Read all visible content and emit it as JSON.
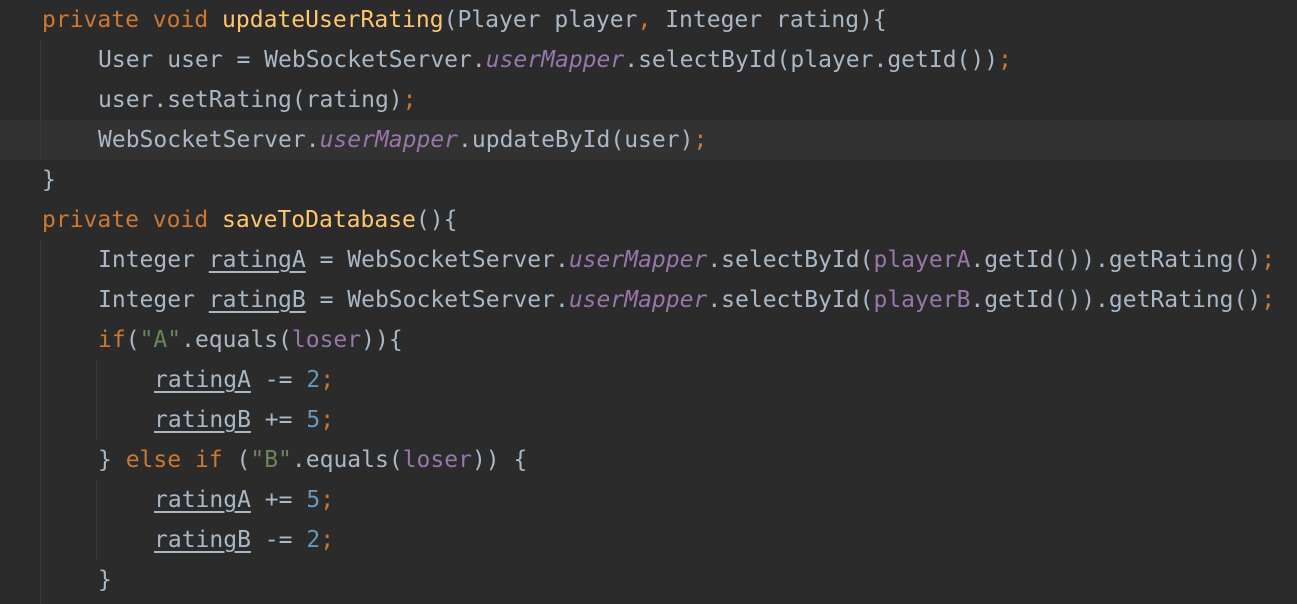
{
  "editor": {
    "theme_colors": {
      "background": "#2b2b2b",
      "current_line": "#323232",
      "keyword": "#cc7832",
      "method": "#ffc66d",
      "field": "#9876aa",
      "string": "#6a8759",
      "number": "#6897bb",
      "text": "#a9b7c6"
    },
    "lines": [
      {
        "tokens": [
          {
            "t": "private",
            "c": "kw"
          },
          {
            "t": " "
          },
          {
            "t": "void",
            "c": "kw"
          },
          {
            "t": " "
          },
          {
            "t": "updateUserRating",
            "c": "fn"
          },
          {
            "t": "(Player player"
          },
          {
            "t": ",",
            "c": "punc"
          },
          {
            "t": " Integer rating){"
          }
        ]
      },
      {
        "tokens": [
          {
            "t": "User user = WebSocketServer."
          },
          {
            "t": "userMapper",
            "c": "sfield"
          },
          {
            "t": ".selectById(player.getId())"
          },
          {
            "t": ";",
            "c": "punc"
          }
        ]
      },
      {
        "tokens": [
          {
            "t": "user.setRating(rating)"
          },
          {
            "t": ";",
            "c": "punc"
          }
        ]
      },
      {
        "tokens": [
          {
            "t": "WebSocketServer."
          },
          {
            "t": "userMapper",
            "c": "sfield"
          },
          {
            "t": ".updateById(user)"
          },
          {
            "t": ";",
            "c": "punc"
          }
        ]
      },
      {
        "tokens": [
          {
            "t": "}"
          }
        ]
      },
      {
        "tokens": [
          {
            "t": "private",
            "c": "kw"
          },
          {
            "t": " "
          },
          {
            "t": "void",
            "c": "kw"
          },
          {
            "t": " "
          },
          {
            "t": "saveToDatabase",
            "c": "fn"
          },
          {
            "t": "(){"
          }
        ]
      },
      {
        "tokens": [
          {
            "t": "Integer "
          },
          {
            "t": "ratingA",
            "c": "ul"
          },
          {
            "t": " = WebSocketServer."
          },
          {
            "t": "userMapper",
            "c": "sfield"
          },
          {
            "t": ".selectById("
          },
          {
            "t": "playerA",
            "c": "field"
          },
          {
            "t": ".getId()).getRating()"
          },
          {
            "t": ";",
            "c": "punc"
          }
        ]
      },
      {
        "tokens": [
          {
            "t": "Integer "
          },
          {
            "t": "ratingB",
            "c": "ul"
          },
          {
            "t": " = WebSocketServer."
          },
          {
            "t": "userMapper",
            "c": "sfield"
          },
          {
            "t": ".selectById("
          },
          {
            "t": "playerB",
            "c": "field"
          },
          {
            "t": ".getId()).getRating()"
          },
          {
            "t": ";",
            "c": "punc"
          }
        ]
      },
      {
        "tokens": [
          {
            "t": "if",
            "c": "kw"
          },
          {
            "t": "("
          },
          {
            "t": "\"A\"",
            "c": "str"
          },
          {
            "t": ".equals("
          },
          {
            "t": "loser",
            "c": "field"
          },
          {
            "t": ")){"
          }
        ]
      },
      {
        "tokens": [
          {
            "t": "ratingA",
            "c": "ul"
          },
          {
            "t": " -= "
          },
          {
            "t": "2",
            "c": "num"
          },
          {
            "t": ";",
            "c": "punc"
          }
        ]
      },
      {
        "tokens": [
          {
            "t": "ratingB",
            "c": "ul"
          },
          {
            "t": " += "
          },
          {
            "t": "5",
            "c": "num"
          },
          {
            "t": ";",
            "c": "punc"
          }
        ]
      },
      {
        "tokens": [
          {
            "t": "} "
          },
          {
            "t": "else",
            "c": "kw"
          },
          {
            "t": " "
          },
          {
            "t": "if",
            "c": "kw"
          },
          {
            "t": " ("
          },
          {
            "t": "\"B\"",
            "c": "str"
          },
          {
            "t": ".equals("
          },
          {
            "t": "loser",
            "c": "field"
          },
          {
            "t": ")) {"
          }
        ]
      },
      {
        "tokens": [
          {
            "t": "ratingA",
            "c": "ul"
          },
          {
            "t": " += "
          },
          {
            "t": "5",
            "c": "num"
          },
          {
            "t": ";",
            "c": "punc"
          }
        ]
      },
      {
        "tokens": [
          {
            "t": "ratingB",
            "c": "ul"
          },
          {
            "t": " -= "
          },
          {
            "t": "2",
            "c": "num"
          },
          {
            "t": ";",
            "c": "punc"
          }
        ]
      },
      {
        "tokens": [
          {
            "t": "}"
          }
        ]
      }
    ]
  }
}
